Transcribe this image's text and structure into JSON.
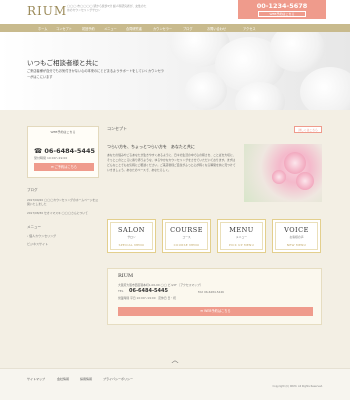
{
  "header": {
    "logo": "RIUM",
    "tagline": "◯◯◯ 市◯◯◯◯ 駅から徒歩5分 婦人科研究者が、女性のためのカウンセリングサロン",
    "tel": "00-1234-5678",
    "cta": "WEB予約はこちら"
  },
  "nav": [
    "ホーム",
    "コンセプト",
    "初回予約",
    "メニュー",
    "合同研究者",
    "カウンセラー",
    "ブログ",
    "お問い合わせ",
    "アクセス"
  ],
  "hero": {
    "title": "いつもご相談者様と共に",
    "text": "ご来店者様が自分でもお気付きかない心の本来のにとどまるようサポートをしていくカウンセラーがはこにいます"
  },
  "sidebar": {
    "contact_head": "WEB予約はこちら",
    "tel": "06-6484-5445",
    "hours": "受付時間 10:00～19:00",
    "contact_btn": "ご予約はこちら",
    "blog_heading": "ブログ",
    "blog_items": [
      "2017/09/20 ◯◯◯カウンセリングのホームページを公開いたしました",
      "2017/08/30 セオイマスキ ◯◯◯さんについて"
    ],
    "menu_heading": "メニュー",
    "menu_item": "個人カウンセリング",
    "footer_link": "ビジネスサイト"
  },
  "concept": {
    "title": "コンセプト",
    "more": "詳しくはこちら",
    "heading": "つらい方を、ちょっとつらい方を　あなたと共に",
    "text": "あなたの悩みやごるあなたが生きやすくあるように、日々の生活の中で心の軽さを、ことばを大切に、そっとこのところに寄り添うような、ゆるやかなカウンセリングをさせていただいております。まずはどんなことでもお気軽にご相談ください。ご来店者様ご自身がふっと心が軽くなる瞬間を共に見つけていきましょう。あなたのペースで、あなたらしく。"
  },
  "menu_cards": [
    {
      "en": "SALON",
      "jp": "サロン",
      "sub": "SPECIAL MENU"
    },
    {
      "en": "COURSE",
      "jp": "コース",
      "sub": "COURSE MENU"
    },
    {
      "en": "MENU",
      "jp": "メニュー",
      "sub": "PICK UP MENU"
    },
    {
      "en": "VOICE",
      "jp": "お客様の声",
      "sub": "NEW MENU"
    }
  ],
  "store": {
    "name": "RIUM",
    "address": "大阪府大阪市西区靭本町1-00-00 ◯◯ ビル5F ［アクセスマップ］",
    "tel_label": "TEL",
    "tel": "06-6484-5445",
    "fax": "FAX 06-6484-5446",
    "hours": "営業時間 平日 10:00～19:00　定休日 日・祝",
    "btn": "WEB予約はこちら"
  },
  "footer": {
    "totop": "︿",
    "links": [
      "サイトマップ",
      "会社情報",
      "採用情報",
      "プライバシーポリシー"
    ],
    "copyright": "Copyright (C) RIUM. All Rights Reserved."
  },
  "colors": {
    "accent": "#ef9b8c",
    "nav": "#c8ba8d",
    "gold": "#e3cf8d"
  }
}
